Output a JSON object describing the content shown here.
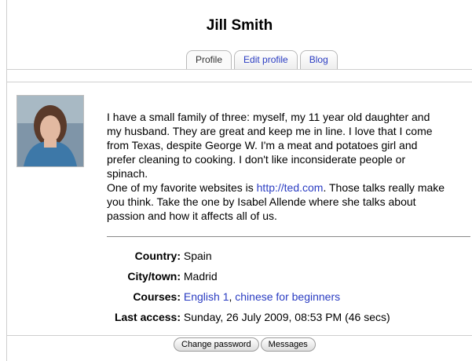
{
  "page": {
    "title": "Jill Smith"
  },
  "tabs": [
    {
      "label": "Profile",
      "active": true
    },
    {
      "label": "Edit profile",
      "active": false
    },
    {
      "label": "Blog",
      "active": false
    }
  ],
  "profile": {
    "avatar_name": "profile-photo",
    "description_lines": [
      "I have a small family of three: myself, my 11 year old daughter and",
      "my husband. They are great and keep me in line. I love that I come",
      "from Texas, despite George W. I'm a meat and potatoes girl and",
      "prefer cleaning to cooking. I don't like inconsiderate people or",
      "spinach."
    ],
    "favorite_prefix": "One of my favorite websites is ",
    "favorite_link": "http://ted.com",
    "favorite_suffix": ". Those talks really make",
    "favorite_line2": "you think. Take the one by Isabel Allende where she talks about",
    "favorite_line3": "passion and how it affects all of us."
  },
  "fields": {
    "country_label": "Country:",
    "country_value": "Spain",
    "city_label": "City/town:",
    "city_value": "Madrid",
    "courses_label": "Courses:",
    "course1": "English 1",
    "course_sep": ", ",
    "course2": "chinese for beginners",
    "last_access_label": "Last access:",
    "last_access_value": "Sunday, 26 July 2009, 08:53 PM  (46 secs)"
  },
  "buttons": {
    "change_password": "Change password",
    "messages": "Messages"
  },
  "colors": {
    "link": "#2a3cc2",
    "border": "#cfcfcf"
  }
}
